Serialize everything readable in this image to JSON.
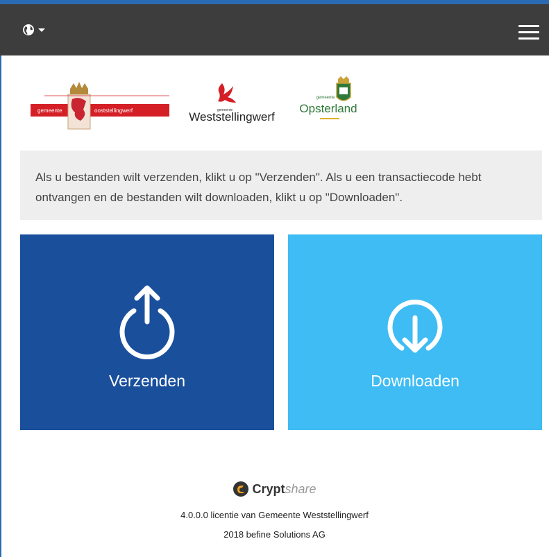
{
  "header": {
    "language_icon": "globe-icon",
    "menu_icon": "hamburger-menu-icon"
  },
  "logos": {
    "oost": {
      "left_text": "gemeente",
      "right_text": "ooststellingwerf"
    },
    "west": {
      "small_text": "gemeente",
      "name": "Weststellingwerf"
    },
    "opst": {
      "small_text": "gemeente",
      "name": "Opsterland"
    }
  },
  "info_text": "Als u bestanden wilt verzenden, klikt u op \"Verzenden\". Als u een transactiecode hebt ontvangen en de bestanden wilt downloaden, klikt u op \"Downloaden\".",
  "tiles": {
    "send": {
      "label": "Verzenden",
      "icon": "upload-power-icon",
      "color": "#1a4f9c"
    },
    "receive": {
      "label": "Downloaden",
      "icon": "download-power-icon",
      "color": "#3ebcf3"
    }
  },
  "footer": {
    "brand_bold": "Crypt",
    "brand_light": "share",
    "license": "4.0.0.0 licentie van Gemeente Weststellingwerf",
    "copyright": "2018 befine Solutions AG"
  }
}
